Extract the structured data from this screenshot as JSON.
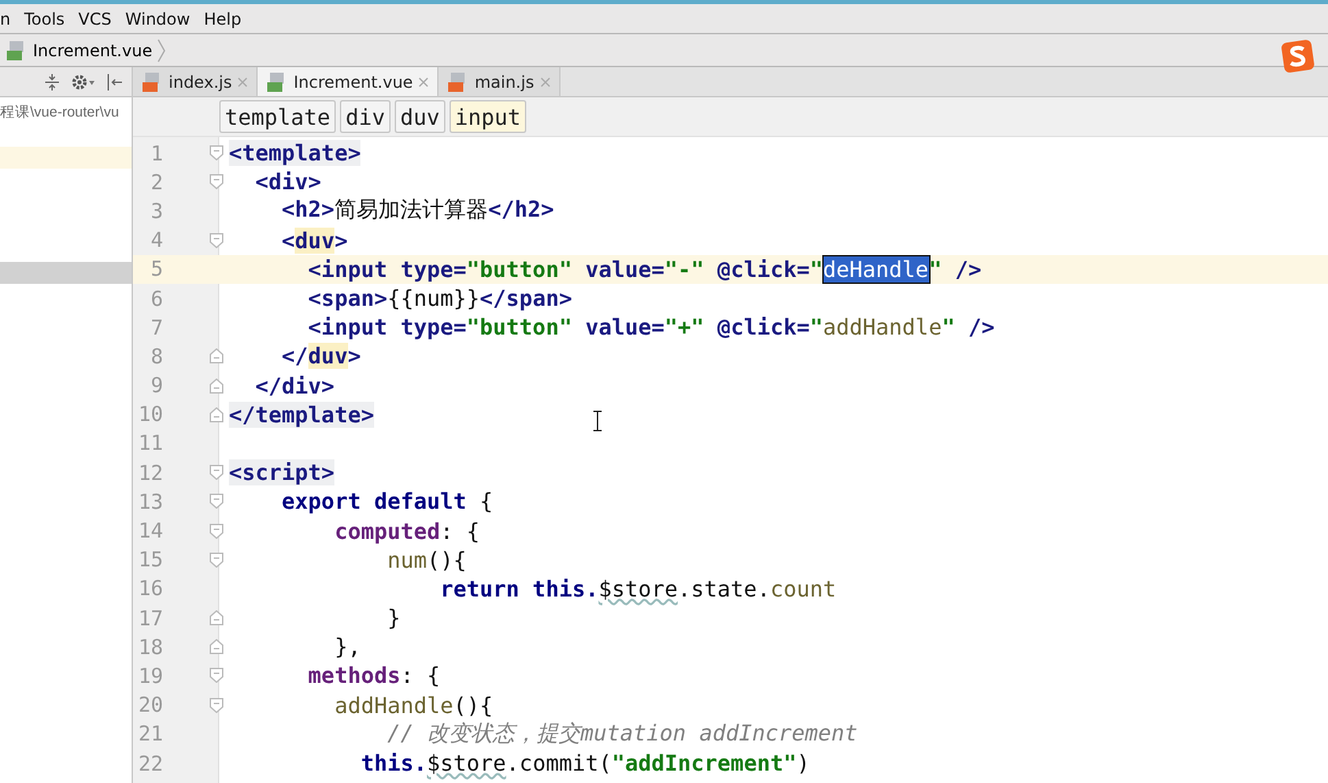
{
  "menu": [
    "n",
    "Tools",
    "VCS",
    "Window",
    "Help"
  ],
  "nav_bar": {
    "file": "Increment.vue"
  },
  "project_panel": {
    "path": "程课\\vue-router\\vu"
  },
  "tabs": [
    {
      "label": "index.js",
      "kind": "js",
      "selected": false
    },
    {
      "label": "Increment.vue",
      "kind": "vue",
      "selected": true
    },
    {
      "label": "main.js",
      "kind": "js",
      "selected": false
    }
  ],
  "breadcrumbs": [
    {
      "label": "template",
      "selected": false
    },
    {
      "label": "div",
      "selected": false
    },
    {
      "label": "duv",
      "selected": false
    },
    {
      "label": "input",
      "selected": true
    }
  ],
  "lines": [
    {
      "number": "1",
      "kind": "fold-start",
      "current": false,
      "tokens": [
        {
          "text": "<template>",
          "kind": "tagbox"
        }
      ]
    },
    {
      "number": "2",
      "kind": "fold-start",
      "current": false,
      "tokens": [
        {
          "text": "  <div>",
          "kind": "tag"
        }
      ]
    },
    {
      "number": "3",
      "kind": "plain",
      "current": false,
      "tokens": [
        {
          "text": "    <h2>",
          "kind": "tag"
        },
        {
          "text": "简易加法计算器",
          "kind": "plain"
        },
        {
          "text": "</h2>",
          "kind": "tag"
        }
      ]
    },
    {
      "number": "4",
      "kind": "fold-start",
      "current": false,
      "tokens": [
        {
          "text": "    <",
          "kind": "tag"
        },
        {
          "text": "duv",
          "kind": "tagmatch"
        },
        {
          "text": ">",
          "kind": "tag"
        }
      ]
    },
    {
      "number": "5",
      "kind": "plain",
      "current": true,
      "tokens": [
        {
          "text": "      <input type=",
          "kind": "tag"
        },
        {
          "text": "\"button\"",
          "kind": "str"
        },
        {
          "text": " value=",
          "kind": "tag"
        },
        {
          "text": "\"-\"",
          "kind": "str"
        },
        {
          "text": " @click=",
          "kind": "tag"
        },
        {
          "text": "\"",
          "kind": "str"
        },
        {
          "text": "deHandle",
          "kind": "sel"
        },
        {
          "text": "\"",
          "kind": "str"
        },
        {
          "text": " />",
          "kind": "tag"
        }
      ]
    },
    {
      "number": "6",
      "kind": "plain",
      "current": false,
      "tokens": [
        {
          "text": "      <span>",
          "kind": "tag"
        },
        {
          "text": "{{num}}",
          "kind": "plain"
        },
        {
          "text": "</span>",
          "kind": "tag"
        }
      ]
    },
    {
      "number": "7",
      "kind": "plain",
      "current": false,
      "tokens": [
        {
          "text": "      <input type=",
          "kind": "tag"
        },
        {
          "text": "\"button\"",
          "kind": "str"
        },
        {
          "text": " value=",
          "kind": "tag"
        },
        {
          "text": "\"+\"",
          "kind": "str"
        },
        {
          "text": " @click=",
          "kind": "tag"
        },
        {
          "text": "\"",
          "kind": "str"
        },
        {
          "text": "addHandle",
          "kind": "fn"
        },
        {
          "text": "\"",
          "kind": "str"
        },
        {
          "text": " />",
          "kind": "tag"
        }
      ]
    },
    {
      "number": "8",
      "kind": "fold-end",
      "current": false,
      "tokens": [
        {
          "text": "    </",
          "kind": "tag"
        },
        {
          "text": "duv",
          "kind": "tagmatch"
        },
        {
          "text": ">",
          "kind": "tag"
        }
      ]
    },
    {
      "number": "9",
      "kind": "fold-end",
      "current": false,
      "tokens": [
        {
          "text": "  </div>",
          "kind": "tag"
        }
      ]
    },
    {
      "number": "10",
      "kind": "fold-end",
      "current": false,
      "tokens": [
        {
          "text": "</template>",
          "kind": "tagbox"
        }
      ]
    },
    {
      "number": "11",
      "kind": "plain",
      "current": false
    },
    {
      "number": "12",
      "kind": "fold-start",
      "current": false,
      "tokens": [
        {
          "text": "<script>",
          "kind": "tagbox"
        }
      ]
    },
    {
      "number": "13",
      "kind": "fold-start",
      "current": false,
      "tokens": [
        {
          "text": "    export default",
          "kind": "kw"
        },
        {
          "text": " {",
          "kind": "plain"
        }
      ]
    },
    {
      "number": "14",
      "kind": "fold-start",
      "current": false,
      "tokens": [
        {
          "text": "        computed",
          "kind": "prop"
        },
        {
          "text": ": {",
          "kind": "plain"
        }
      ]
    },
    {
      "number": "15",
      "kind": "fold-start",
      "current": false,
      "tokens": [
        {
          "text": "            num",
          "kind": "fn"
        },
        {
          "text": "(){",
          "kind": "plain"
        }
      ]
    },
    {
      "number": "16",
      "kind": "plain",
      "current": false,
      "tokens": [
        {
          "text": "                return this.",
          "kind": "kw"
        },
        {
          "text": "$store",
          "kind": "wavy"
        },
        {
          "text": ".state.",
          "kind": "plain"
        },
        {
          "text": "count",
          "kind": "fn"
        }
      ]
    },
    {
      "number": "17",
      "kind": "fold-end",
      "current": false,
      "tokens": [
        {
          "text": "            }",
          "kind": "plain"
        }
      ]
    },
    {
      "number": "18",
      "kind": "fold-end",
      "current": false,
      "tokens": [
        {
          "text": "        },",
          "kind": "plain"
        }
      ]
    },
    {
      "number": "19",
      "kind": "fold-start",
      "current": false,
      "tokens": [
        {
          "text": "      methods",
          "kind": "prop"
        },
        {
          "text": ": {",
          "kind": "plain"
        }
      ]
    },
    {
      "number": "20",
      "kind": "fold-start",
      "current": false,
      "tokens": [
        {
          "text": "        addHandle",
          "kind": "fn"
        },
        {
          "text": "(){",
          "kind": "plain"
        }
      ]
    },
    {
      "number": "21",
      "kind": "plain",
      "current": false,
      "tokens": [
        {
          "text": "            // 改变状态，提交mutation addIncrement",
          "kind": "comment"
        }
      ]
    },
    {
      "number": "22",
      "kind": "plain",
      "current": false,
      "tokens": [
        {
          "text": "          this.",
          "kind": "kw"
        },
        {
          "text": "$store",
          "kind": "wavy"
        },
        {
          "text": ".commit(",
          "kind": "plain"
        },
        {
          "text": "\"addIncrement\"",
          "kind": "str"
        },
        {
          "text": ")",
          "kind": "plain"
        }
      ]
    }
  ]
}
